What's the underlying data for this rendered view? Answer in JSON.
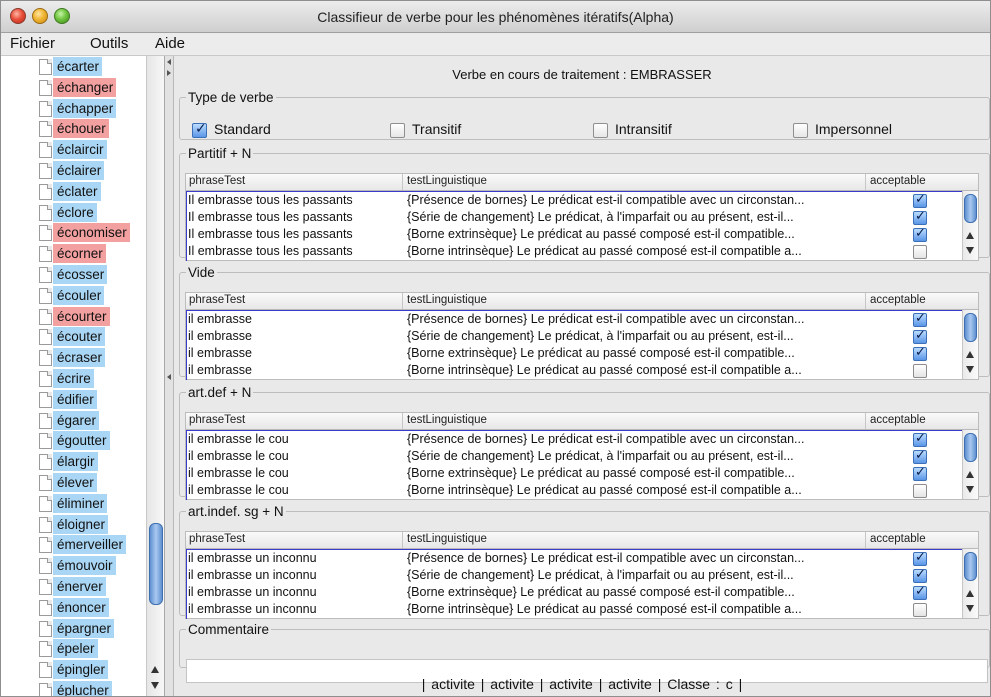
{
  "window": {
    "title": "Classifieur de verbe pour les phénomènes itératifs(Alpha)"
  },
  "menu": [
    "Fichier",
    "Outils",
    "Aide"
  ],
  "verbs": [
    {
      "label": "écarter",
      "color": "blue"
    },
    {
      "label": "échanger",
      "color": "red"
    },
    {
      "label": "échapper",
      "color": "blue"
    },
    {
      "label": "échouer",
      "color": "red"
    },
    {
      "label": "éclaircir",
      "color": "blue"
    },
    {
      "label": "éclairer",
      "color": "blue"
    },
    {
      "label": "éclater",
      "color": "blue"
    },
    {
      "label": "éclore",
      "color": "blue"
    },
    {
      "label": "économiser",
      "color": "red"
    },
    {
      "label": "écorner",
      "color": "red"
    },
    {
      "label": "écosser",
      "color": "blue"
    },
    {
      "label": "écouler",
      "color": "blue"
    },
    {
      "label": "écourter",
      "color": "red"
    },
    {
      "label": "écouter",
      "color": "blue"
    },
    {
      "label": "écraser",
      "color": "blue"
    },
    {
      "label": "écrire",
      "color": "blue"
    },
    {
      "label": "édifier",
      "color": "blue"
    },
    {
      "label": "égarer",
      "color": "blue"
    },
    {
      "label": "égoutter",
      "color": "blue"
    },
    {
      "label": "élargir",
      "color": "blue"
    },
    {
      "label": "élever",
      "color": "blue"
    },
    {
      "label": "éliminer",
      "color": "blue"
    },
    {
      "label": "éloigner",
      "color": "blue"
    },
    {
      "label": "émerveiller",
      "color": "blue"
    },
    {
      "label": "émouvoir",
      "color": "blue"
    },
    {
      "label": "énerver",
      "color": "blue"
    },
    {
      "label": "énoncer",
      "color": "blue"
    },
    {
      "label": "épargner",
      "color": "blue"
    },
    {
      "label": "épeler",
      "color": "blue"
    },
    {
      "label": "épingler",
      "color": "blue"
    },
    {
      "label": "éplucher",
      "color": "blue"
    }
  ],
  "current_verb": "Verbe en cours de traitement : EMBRASSER",
  "verb_type": {
    "legend": "Type de verbe",
    "options": [
      {
        "label": "Standard",
        "checked": true
      },
      {
        "label": "Transitif",
        "checked": false
      },
      {
        "label": "Intransitif",
        "checked": false
      },
      {
        "label": "Impersonnel",
        "checked": false
      }
    ]
  },
  "columns": {
    "phrase": "phraseTest",
    "test": "testLinguistique",
    "acceptable": "acceptable"
  },
  "groups": [
    {
      "legend": "Partitif + N",
      "rows": [
        {
          "phrase": "Il embrasse tous les passants",
          "test": "{Présence de bornes} Le prédicat est-il compatible avec un circonstan...",
          "acceptable": true
        },
        {
          "phrase": "Il embrasse tous les passants",
          "test": "{Série de changement} Le prédicat, à l'imparfait ou au présent, est-il...",
          "acceptable": true
        },
        {
          "phrase": "Il embrasse tous les passants",
          "test": "{Borne extrinsèque} Le prédicat au passé composé est-il compatible...",
          "acceptable": true
        },
        {
          "phrase": "Il embrasse tous les passants",
          "test": "{Borne intrinsèque} Le prédicat au passé composé est-il compatible a...",
          "acceptable": false
        }
      ]
    },
    {
      "legend": "Vide",
      "rows": [
        {
          "phrase": "il embrasse",
          "test": "{Présence de bornes} Le prédicat est-il compatible avec un circonstan...",
          "acceptable": true
        },
        {
          "phrase": "il embrasse",
          "test": "{Série de changement} Le prédicat, à l'imparfait ou au présent, est-il...",
          "acceptable": true
        },
        {
          "phrase": "il embrasse",
          "test": "{Borne extrinsèque} Le prédicat au passé composé est-il compatible...",
          "acceptable": true
        },
        {
          "phrase": "il embrasse",
          "test": "{Borne intrinsèque} Le prédicat au passé composé est-il compatible a...",
          "acceptable": false
        }
      ]
    },
    {
      "legend": "art.def + N",
      "rows": [
        {
          "phrase": "il embrasse le cou",
          "test": "{Présence de bornes} Le prédicat est-il compatible avec un circonstan...",
          "acceptable": true
        },
        {
          "phrase": "il embrasse le cou",
          "test": "{Série de changement} Le prédicat, à l'imparfait ou au présent, est-il...",
          "acceptable": true
        },
        {
          "phrase": "il embrasse le cou",
          "test": "{Borne extrinsèque} Le prédicat au passé composé est-il compatible...",
          "acceptable": true
        },
        {
          "phrase": "il embrasse le cou",
          "test": "{Borne intrinsèque} Le prédicat au passé composé est-il compatible a...",
          "acceptable": false
        }
      ]
    },
    {
      "legend": "art.indef. sg + N",
      "rows": [
        {
          "phrase": "il embrasse un inconnu",
          "test": "{Présence de bornes} Le prédicat est-il compatible avec un circonstan...",
          "acceptable": true
        },
        {
          "phrase": "il embrasse un inconnu",
          "test": "{Série de changement} Le prédicat, à l'imparfait ou au présent, est-il...",
          "acceptable": true
        },
        {
          "phrase": "il embrasse un inconnu",
          "test": "{Borne extrinsèque} Le prédicat au passé composé est-il compatible...",
          "acceptable": true
        },
        {
          "phrase": "il embrasse un inconnu",
          "test": "{Borne intrinsèque} Le prédicat au passé composé est-il compatible a...",
          "acceptable": false
        }
      ]
    }
  ],
  "comment": {
    "legend": "Commentaire",
    "value": ""
  },
  "status": "| activite | activite | activite | activite | Classe : c |"
}
